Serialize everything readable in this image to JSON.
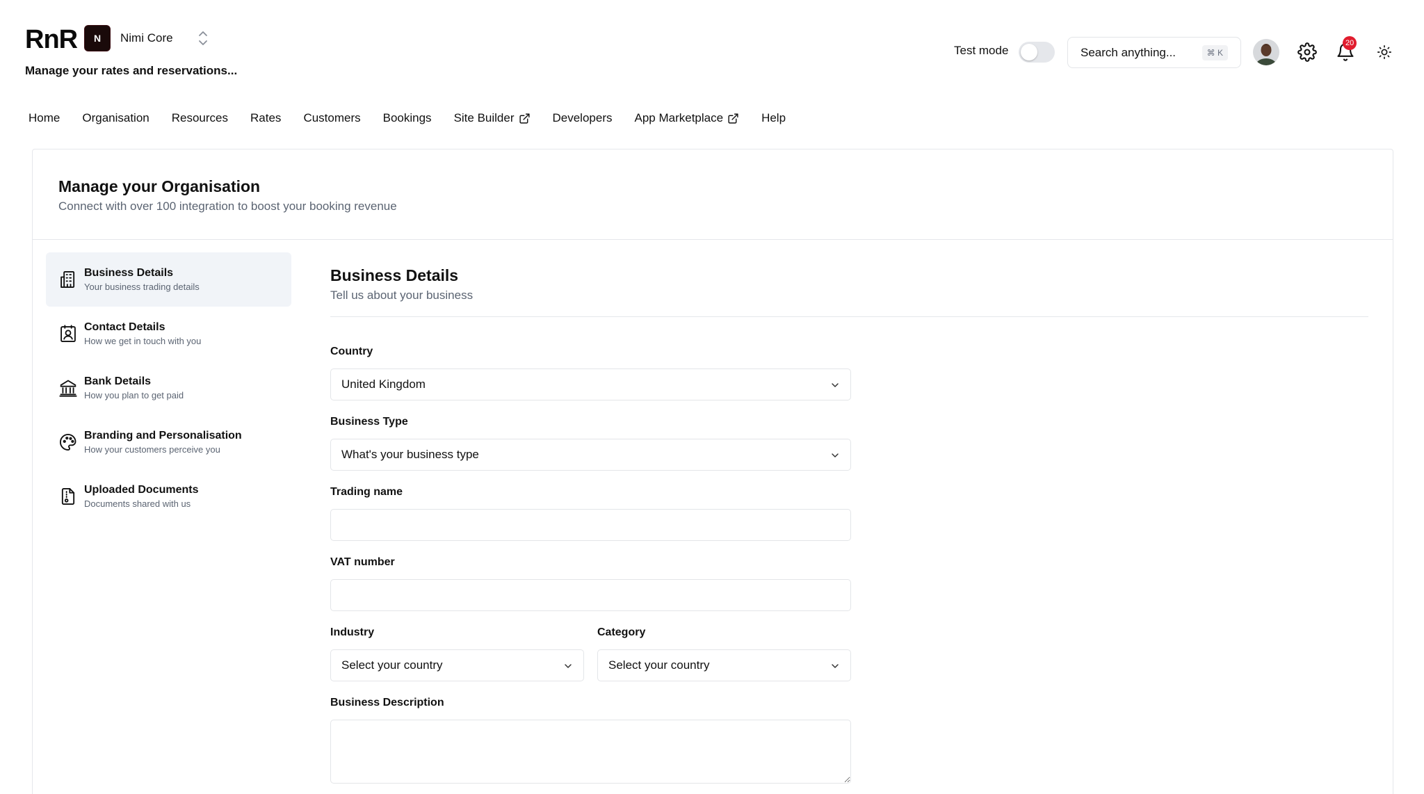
{
  "app": {
    "logo": "RnR",
    "org_initial": "N",
    "org_name": "Nimi Core",
    "tagline": "Manage your rates and reservations..."
  },
  "header": {
    "test_mode_label": "Test mode",
    "test_mode_on": false,
    "search_placeholder": "Search anything...",
    "search_shortcut": "⌘ K",
    "notification_count": "20"
  },
  "nav": {
    "items": [
      {
        "label": "Home",
        "external": false
      },
      {
        "label": "Organisation",
        "external": false
      },
      {
        "label": "Resources",
        "external": false
      },
      {
        "label": "Rates",
        "external": false
      },
      {
        "label": "Customers",
        "external": false
      },
      {
        "label": "Bookings",
        "external": false
      },
      {
        "label": "Site Builder",
        "external": true
      },
      {
        "label": "Developers",
        "external": false
      },
      {
        "label": "App Marketplace",
        "external": true
      },
      {
        "label": "Help",
        "external": false
      }
    ]
  },
  "page": {
    "title": "Manage your Organisation",
    "subtitle": "Connect with over 100 integration to boost your booking revenue"
  },
  "sidebar": {
    "items": [
      {
        "title": "Business Details",
        "desc": "Your business trading details",
        "icon": "building-icon",
        "active": true
      },
      {
        "title": "Contact Details",
        "desc": "How we get in touch with you",
        "icon": "contact-card-icon",
        "active": false
      },
      {
        "title": "Bank Details",
        "desc": "How you plan to get paid",
        "icon": "bank-icon",
        "active": false
      },
      {
        "title": "Branding and Personalisation",
        "desc": "How your customers perceive you",
        "icon": "palette-icon",
        "active": false
      },
      {
        "title": "Uploaded Documents",
        "desc": "Documents shared with us",
        "icon": "document-icon",
        "active": false
      }
    ]
  },
  "form": {
    "title": "Business Details",
    "subtitle": "Tell us about your business",
    "country_label": "Country",
    "country_value": "United Kingdom",
    "business_type_label": "Business Type",
    "business_type_value": "What's your business type",
    "trading_name_label": "Trading name",
    "trading_name_value": "",
    "vat_label": "VAT number",
    "vat_value": "",
    "industry_label": "Industry",
    "industry_value": "Select your country",
    "category_label": "Category",
    "category_value": "Select your country",
    "description_label": "Business Description",
    "description_value": ""
  },
  "colors": {
    "active_bg": "#f1f4f8",
    "badge": "#e11d2e",
    "border": "#e3e5e8",
    "muted_text": "#5b6472"
  }
}
